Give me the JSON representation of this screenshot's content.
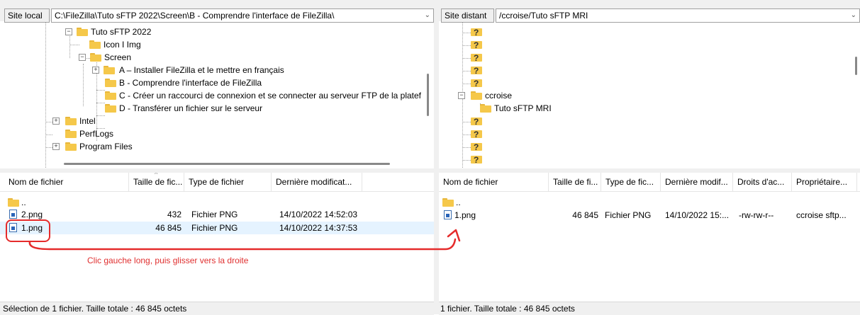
{
  "local": {
    "label": "Site local :",
    "path": "C:\\FileZilla\\Tuto sFTP 2022\\Screen\\B - Comprendre l'interface de FileZilla\\",
    "tree": [
      "Tuto sFTP 2022",
      "Icon I Img",
      "Screen",
      "A – Installer FileZilla et le mettre en français",
      "B - Comprendre l'interface de FileZilla",
      "C - Créer un raccourci de connexion et se connecter au serveur FTP de la platef",
      "D - Transférer un fichier sur le serveur",
      "Intel",
      "PerfLogs",
      "Program Files"
    ],
    "columns": [
      "Nom de fichier",
      "Taille de fic...",
      "Type de fichier",
      "Dernière modificat..."
    ],
    "files": [
      {
        "name": "..",
        "size": "",
        "type": "",
        "modified": ""
      },
      {
        "name": "2.png",
        "size": "432",
        "type": "Fichier PNG",
        "modified": "14/10/2022 14:52:03"
      },
      {
        "name": "1.png",
        "size": "46 845",
        "type": "Fichier PNG",
        "modified": "14/10/2022 14:37:53"
      }
    ],
    "status": "Sélection de 1 fichier. Taille totale : 46 845 octets"
  },
  "remote": {
    "label": "Site distant :",
    "path": "/ccroise/Tuto sFTP MRI",
    "tree": [
      {
        "label": "?",
        "kind": "unknown"
      },
      {
        "label": "?",
        "kind": "unknown"
      },
      {
        "label": "?",
        "kind": "unknown"
      },
      {
        "label": "?",
        "kind": "unknown"
      },
      {
        "label": "?",
        "kind": "unknown"
      },
      {
        "label": "ccroise",
        "kind": "folder"
      },
      {
        "label": "Tuto sFTP MRI",
        "kind": "folder"
      },
      {
        "label": "?",
        "kind": "unknown"
      },
      {
        "label": "?",
        "kind": "unknown"
      },
      {
        "label": "?",
        "kind": "unknown"
      },
      {
        "label": "?",
        "kind": "unknown"
      }
    ],
    "columns": [
      "Nom de fichier",
      "Taille de fi...",
      "Type de fic...",
      "Dernière modif...",
      "Droits d'ac...",
      "Propriétaire..."
    ],
    "files": [
      {
        "name": "..",
        "size": "",
        "type": "",
        "modified": "",
        "perms": "",
        "owner": ""
      },
      {
        "name": "1.png",
        "size": "46 845",
        "type": "Fichier PNG",
        "modified": "14/10/2022 15:...",
        "perms": "-rw-rw-r--",
        "owner": "ccroise sftp..."
      }
    ],
    "status": "1 fichier. Taille totale : 46 845 octets"
  },
  "annotation": {
    "text": "Clic gauche long, puis glisser vers la droite",
    "color": "#e03030"
  },
  "colors": {
    "selection": "#e5f3ff",
    "folder": "#f5c84a",
    "chrome": "#f0f0f0"
  }
}
